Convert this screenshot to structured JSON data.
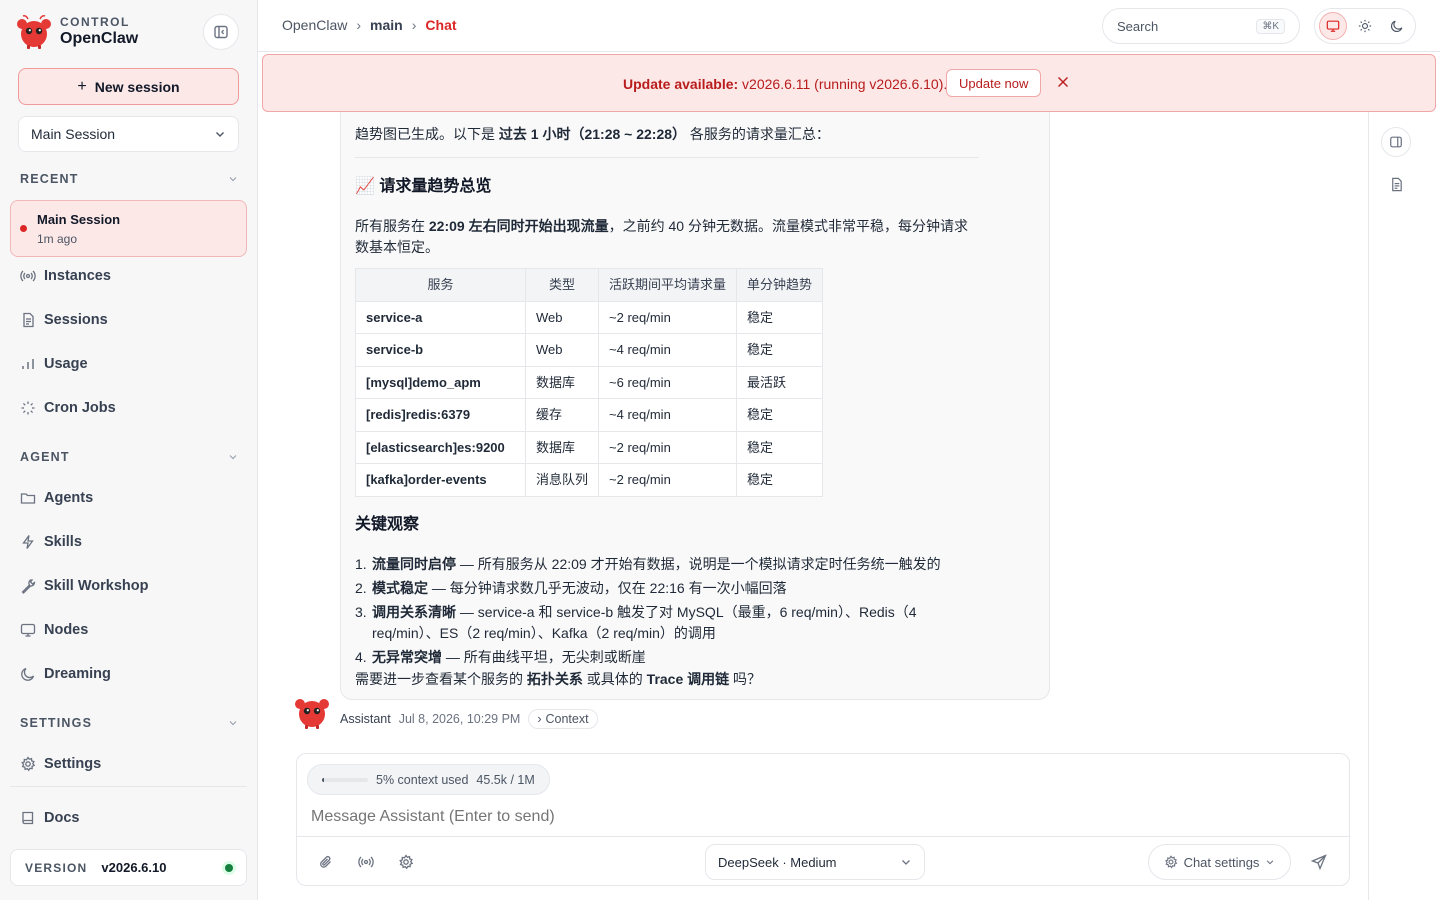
{
  "brand": {
    "super": "CONTROL",
    "name": "OpenClaw"
  },
  "sidebar": {
    "new_session": "New session",
    "session_select": "Main Session",
    "recent_heading": "RECENT",
    "recent_item": {
      "title": "Main Session",
      "sub": "1m ago"
    },
    "nav_primary": [
      {
        "label": "Instances",
        "icon": "broadcast-icon"
      },
      {
        "label": "Sessions",
        "icon": "document-icon"
      },
      {
        "label": "Usage",
        "icon": "bar-chart-icon"
      },
      {
        "label": "Cron Jobs",
        "icon": "loader-icon"
      }
    ],
    "agent_heading": "AGENT",
    "nav_agent": [
      {
        "label": "Agents",
        "icon": "folder-icon"
      },
      {
        "label": "Skills",
        "icon": "bolt-icon"
      },
      {
        "label": "Skill Workshop",
        "icon": "wrench-icon"
      },
      {
        "label": "Nodes",
        "icon": "monitor-icon"
      },
      {
        "label": "Dreaming",
        "icon": "moon-icon"
      }
    ],
    "settings_heading": "SETTINGS",
    "settings_item": "Settings",
    "docs": "Docs",
    "version_label": "VERSION",
    "version_value": "v2026.6.10",
    "status_color": "#15803d"
  },
  "topbar": {
    "crumbs": [
      "OpenClaw",
      "main",
      "Chat"
    ],
    "search_placeholder": "Search",
    "search_kbd": "⌘K",
    "theme_modes": [
      "system",
      "light",
      "dark"
    ],
    "theme_active": "system"
  },
  "banner": {
    "label": "Update available:",
    "text": " v2026.6.11 (running v2026.6.10).",
    "button": "Update now",
    "bg": "#fde8e8"
  },
  "message": {
    "intro_a": "趋势图已生成。以下是 ",
    "intro_b": "过去 1 小时（21:28 ~ 22:28）",
    "intro_c": " 各服务的请求量汇总：",
    "h_overview": "📈 请求量趋势总览",
    "para_a": "所有服务在 ",
    "para_b": "22:09 左右同时开始出现流量",
    "para_c": "，之前约 40 分钟无数据。流量模式非常平稳，每分钟请求数基本恒定。",
    "table": {
      "headers": [
        "服务",
        "类型",
        "活跃期间平均请求量",
        "单分钟趋势"
      ],
      "rows": [
        [
          "service-a",
          "Web",
          "~2 req/min",
          "稳定"
        ],
        [
          "service-b",
          "Web",
          "~4 req/min",
          "稳定"
        ],
        [
          "[mysql]demo_apm",
          "数据库",
          "~6 req/min",
          "最活跃"
        ],
        [
          "[redis]redis:6379",
          "缓存",
          "~4 req/min",
          "稳定"
        ],
        [
          "[elasticsearch]es:9200",
          "数据库",
          "~2 req/min",
          "稳定"
        ],
        [
          "[kafka]order-events",
          "消息队列",
          "~2 req/min",
          "稳定"
        ]
      ]
    },
    "h_obs": "关键观察",
    "observations": [
      {
        "n": "1.",
        "b": "流量同时启停",
        "t": " — 所有服务从 22:09 才开始有数据，说明是一个模拟请求定时任务统一触发的"
      },
      {
        "n": "2.",
        "b": "模式稳定",
        "t": " — 每分钟请求数几乎无波动，仅在 22:16 有一次小幅回落"
      },
      {
        "n": "3.",
        "b": "调用关系清晰",
        "t": " — service-a 和 service-b 触发了对 MySQL（最重，6 req/min）、Redis（4 req/min）、ES（2 req/min）、Kafka（2 req/min）的调用"
      },
      {
        "n": "4.",
        "b": "无异常突增",
        "t": " — 所有曲线平坦，无尖刺或断崖"
      }
    ],
    "tail_a": "需要进一步查看某个服务的 ",
    "tail_b": "拓扑关系",
    "tail_c": " 或具体的 ",
    "tail_d": "Trace 调用链",
    "tail_e": " 吗？",
    "sender": "Assistant",
    "timestamp": "Jul 8, 2026, 10:29 PM",
    "context_label": "Context"
  },
  "composer": {
    "context_used": "5% context used",
    "context_tokens": "45.5k / 1M",
    "context_fraction": 0.05,
    "placeholder": "Message Assistant (Enter to send)",
    "model": "DeepSeek · Medium",
    "chat_settings": "Chat settings"
  },
  "colors": {
    "accent": "#dc2626",
    "accent_bg": "#fde8e8"
  }
}
